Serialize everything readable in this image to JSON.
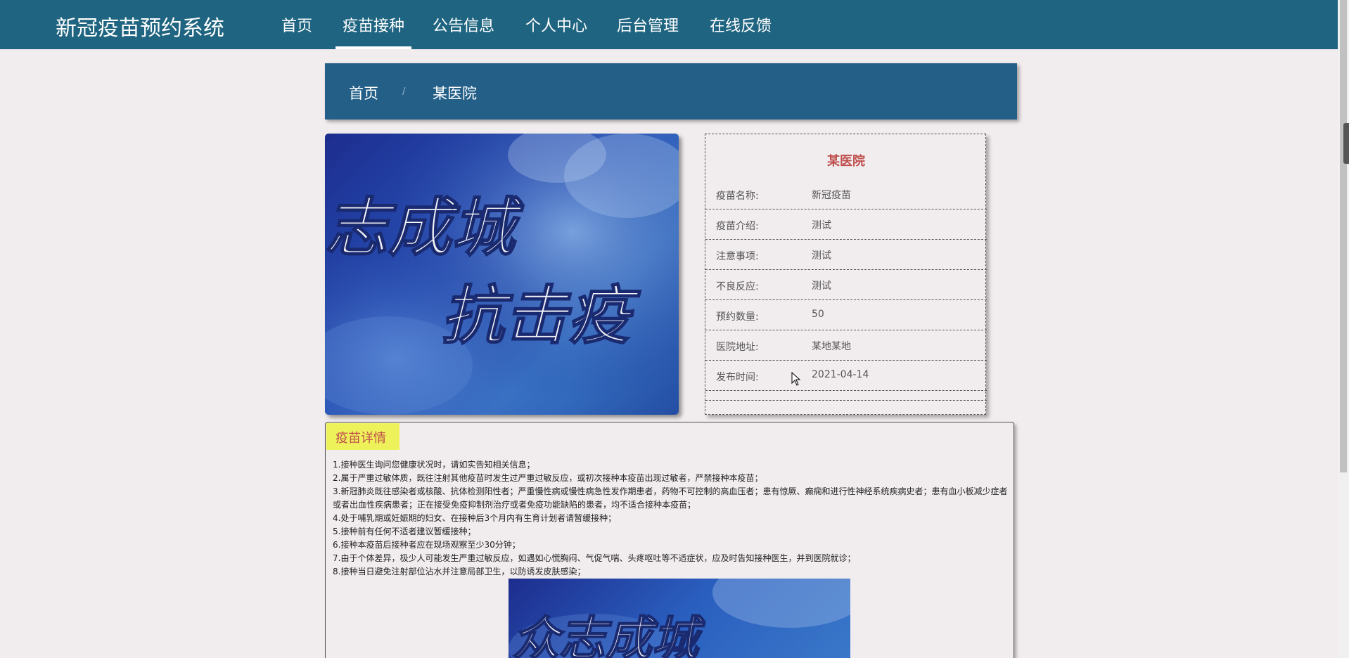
{
  "app": {
    "title": "新冠疫苗预约系统"
  },
  "nav": {
    "items": [
      {
        "label": "首页"
      },
      {
        "label": "疫苗接种"
      },
      {
        "label": "公告信息"
      },
      {
        "label": "个人中心"
      },
      {
        "label": "后台管理"
      },
      {
        "label": "在线反馈"
      }
    ],
    "active": "疫苗接种"
  },
  "breadcrumb": {
    "home": "首页",
    "separator": "/",
    "current": "某医院"
  },
  "banner": {
    "line1": "志成城",
    "line2": "抗击疫"
  },
  "info": {
    "title": "某医院",
    "rows": [
      {
        "label": "疫苗名称:",
        "value": "新冠疫苗"
      },
      {
        "label": "疫苗介绍:",
        "value": "测试"
      },
      {
        "label": "注意事项:",
        "value": "测试"
      },
      {
        "label": "不良反应:",
        "value": "测试"
      },
      {
        "label": "预约数量:",
        "value": "50"
      },
      {
        "label": "医院地址:",
        "value": "某地某地"
      },
      {
        "label": "发布时间:",
        "value": "2021-04-14"
      }
    ]
  },
  "detail": {
    "tag": "疫苗详情",
    "lines": [
      "1.接种医生询问您健康状况时，请如实告知相关信息；",
      "2.属于严重过敏体质，既往注射其他疫苗时发生过严重过敏反应，或初次接种本疫苗出现过敏者，严禁接种本疫苗；",
      "3.新冠肺炎既往感染者或核酸、抗体检测阳性者；严重慢性病或慢性病急性发作期患者，药物不可控制的高血压者；患有惊厥、癫痫和进行性神经系统疾病史者；患有血小板减少症者或者出血性疾病患者；正在接受免疫抑制剂治疗或者免疫功能缺陷的患者，均不适合接种本疫苗；",
      "4.处于哺乳期或妊娠期的妇女、在接种后3个月内有生育计划者请暂缓接种；",
      "5.接种前有任何不适者建议暂缓接种；",
      "6.接种本疫苗后接种者应在现场观察至少30分钟；",
      "7.由于个体差异，极少人可能发生严重过敏反应，如遇如心慌胸闷、气促气喘、头疼呕吐等不适症状，应及时告知接种医生，并到医院就诊；",
      "8.接种当日避免注射部位沾水并注意局部卫生，以防诱发皮肤感染；"
    ],
    "image_text": "众志成城"
  },
  "colors": {
    "topbar": "#1f6480",
    "breadcrumb": "#245f88",
    "accent": "#c0504d",
    "tag": "#eef25a"
  }
}
